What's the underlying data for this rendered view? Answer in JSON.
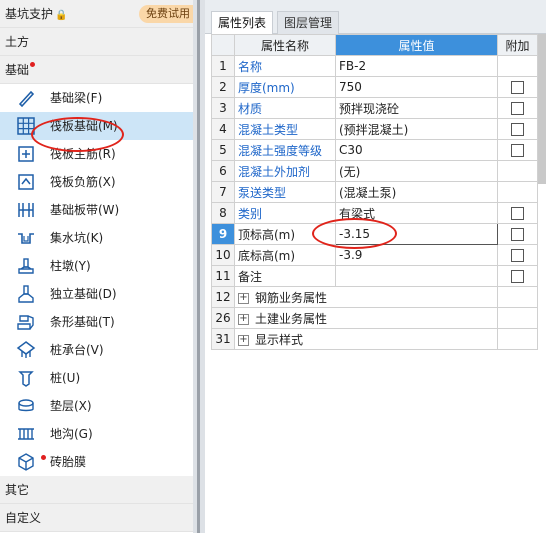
{
  "left_nav": {
    "top_category": {
      "label": "基坑支护",
      "lock_icon": "🔒",
      "trial_badge": "免费试用"
    },
    "earthwork": {
      "label": "土方"
    },
    "foundation": {
      "label": "基础",
      "has_red_dot": true
    },
    "items": [
      {
        "label": "基础梁(F)",
        "icon": "beam-icon",
        "selected": false
      },
      {
        "label": "筏板基础(M)",
        "icon": "raft-grid-icon",
        "selected": true
      },
      {
        "label": "筏板主筋(R)",
        "icon": "raft-rebar-icon",
        "selected": false
      },
      {
        "label": "筏板负筋(X)",
        "icon": "raft-neg-rebar-icon",
        "selected": false
      },
      {
        "label": "基础板带(W)",
        "icon": "slab-strip-icon",
        "selected": false
      },
      {
        "label": "集水坑(K)",
        "icon": "sump-pit-icon",
        "selected": false
      },
      {
        "label": "柱墩(Y)",
        "icon": "column-pier-icon",
        "selected": false
      },
      {
        "label": "独立基础(D)",
        "icon": "isolated-footing-icon",
        "selected": false
      },
      {
        "label": "条形基础(T)",
        "icon": "strip-footing-icon",
        "selected": false
      },
      {
        "label": "桩承台(V)",
        "icon": "pile-cap-icon",
        "selected": false
      },
      {
        "label": "桩(U)",
        "icon": "pile-icon",
        "selected": false
      },
      {
        "label": "垫层(X)",
        "icon": "cushion-icon",
        "selected": false
      },
      {
        "label": "地沟(G)",
        "icon": "trench-icon",
        "selected": false
      },
      {
        "label": "砖胎膜",
        "icon": "brick-mold-icon",
        "selected": false,
        "has_red_dot": true
      }
    ],
    "other": {
      "label": "其它"
    },
    "custom": {
      "label": "自定义"
    }
  },
  "panel": {
    "tabs": [
      {
        "label": "属性列表",
        "active": true
      },
      {
        "label": "图层管理",
        "active": false
      }
    ],
    "headers": {
      "num": "",
      "name": "属性名称",
      "value": "属性值",
      "add": "附加"
    },
    "rows": [
      {
        "num": "1",
        "name": "名称",
        "value": "FB-2",
        "blue": true,
        "checkbox": false
      },
      {
        "num": "2",
        "name": "厚度(mm)",
        "value": "750",
        "blue": true,
        "checkbox": true
      },
      {
        "num": "3",
        "name": "材质",
        "value": "预拌现浇砼",
        "blue": true,
        "checkbox": true
      },
      {
        "num": "4",
        "name": "混凝土类型",
        "value": "(预拌混凝土)",
        "blue": true,
        "checkbox": true
      },
      {
        "num": "5",
        "name": "混凝土强度等级",
        "value": "C30",
        "blue": true,
        "checkbox": true
      },
      {
        "num": "6",
        "name": "混凝土外加剂",
        "value": "(无)",
        "blue": true,
        "checkbox": false
      },
      {
        "num": "7",
        "name": "泵送类型",
        "value": "(混凝土泵)",
        "blue": true,
        "checkbox": false
      },
      {
        "num": "8",
        "name": "类别",
        "value": "有梁式",
        "blue": true,
        "checkbox": true
      },
      {
        "num": "9",
        "name": "顶标高(m)",
        "value": "-3.15",
        "blue": false,
        "checkbox": true,
        "current": true
      },
      {
        "num": "10",
        "name": "底标高(m)",
        "value": "-3.9",
        "blue": false,
        "checkbox": true
      },
      {
        "num": "11",
        "name": "备注",
        "value": "",
        "blue": false,
        "checkbox": true
      }
    ],
    "groups": [
      {
        "num": "12",
        "label": "钢筋业务属性",
        "expand": "+"
      },
      {
        "num": "26",
        "label": "土建业务属性",
        "expand": "+"
      },
      {
        "num": "31",
        "label": "显示样式",
        "expand": "+"
      }
    ]
  },
  "colors": {
    "accent": "#3d90dc",
    "selected_bg": "#cde5f7",
    "annotation": "#e0241b",
    "blue_text": "#1e66c9"
  }
}
